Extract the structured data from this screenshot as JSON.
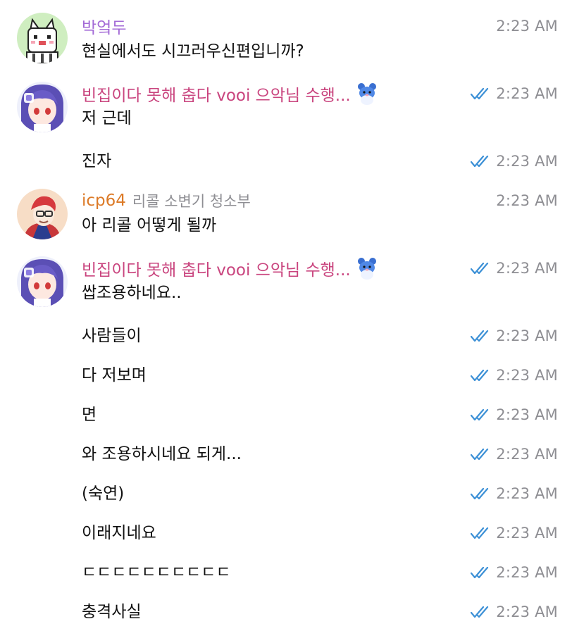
{
  "colors": {
    "sender_purple": "#a36ad6",
    "sender_pink": "#c9447e",
    "sender_orange": "#dc7a27",
    "role_gray": "#8e8e93",
    "check_blue": "#3c90d6",
    "time_gray": "#8e8e93"
  },
  "groups": [
    {
      "sender": "박엌두",
      "role": "",
      "avatar_icon": "pixel-cat-avatar",
      "messages": [
        {
          "text": "현실에서도 시끄러우신편입니까?",
          "time": "2:23 AM",
          "read": false
        }
      ]
    },
    {
      "sender": "빈집이다 못해 춥다 vooi 으악님 수행...",
      "role": "",
      "avatar_icon": "anime-girl-avatar",
      "sticker_icon": "marill-sticker-icon",
      "messages": [
        {
          "text": "저 근데",
          "time": "2:23 AM",
          "read": true
        },
        {
          "text": "진자",
          "time": "2:23 AM",
          "read": true
        }
      ]
    },
    {
      "sender": "icp64",
      "role": "리콜 소변기 청소부",
      "avatar_icon": "anime-boy-avatar",
      "messages": [
        {
          "text": "아 리콜 어떻게 될까",
          "time": "2:23 AM",
          "read": false
        }
      ]
    },
    {
      "sender": "빈집이다 못해 춥다 vooi 으악님 수행...",
      "role": "",
      "avatar_icon": "anime-girl-avatar",
      "sticker_icon": "marill-sticker-icon",
      "messages": [
        {
          "text": "쌉조용하네요..",
          "time": "2:23 AM",
          "read": true
        },
        {
          "text": "사람들이",
          "time": "2:23 AM",
          "read": true
        },
        {
          "text": "다 저보며",
          "time": "2:23 AM",
          "read": true
        },
        {
          "text": "면",
          "time": "2:23 AM",
          "read": true
        },
        {
          "text": "와 조용하시네요 되게...",
          "time": "2:23 AM",
          "read": true
        },
        {
          "text": "(숙연)",
          "time": "2:23 AM",
          "read": true
        },
        {
          "text": "이래지네요",
          "time": "2:23 AM",
          "read": true
        },
        {
          "text": "ㄷㄷㄷㄷㄷㄷㄷㄷㄷㄷ",
          "time": "2:23 AM",
          "read": true
        },
        {
          "text": "충격사실",
          "time": "2:23 AM",
          "read": true
        }
      ]
    }
  ]
}
